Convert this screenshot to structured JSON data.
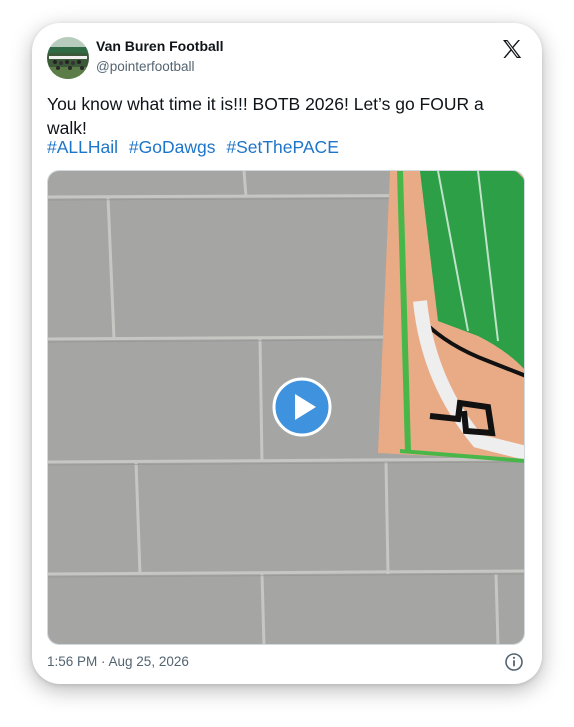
{
  "post": {
    "display_name": "Van Buren Football",
    "handle": "@pointerfootball",
    "text": "You know what time it is!!! BOTB 2026! Let’s go FOUR a walk!",
    "hashtags": [
      "#ALLHail",
      "#GoDawgs",
      "#SetThePACE"
    ],
    "timestamp": "1:56 PM · Aug 25, 2026"
  },
  "icons": {
    "brand": "x-logo-icon",
    "play": "play-icon",
    "info": "info-icon"
  },
  "colors": {
    "link": "#1d75c9",
    "play_button": "#3f92dd",
    "text_primary": "#0f1419",
    "text_secondary": "#536471"
  }
}
